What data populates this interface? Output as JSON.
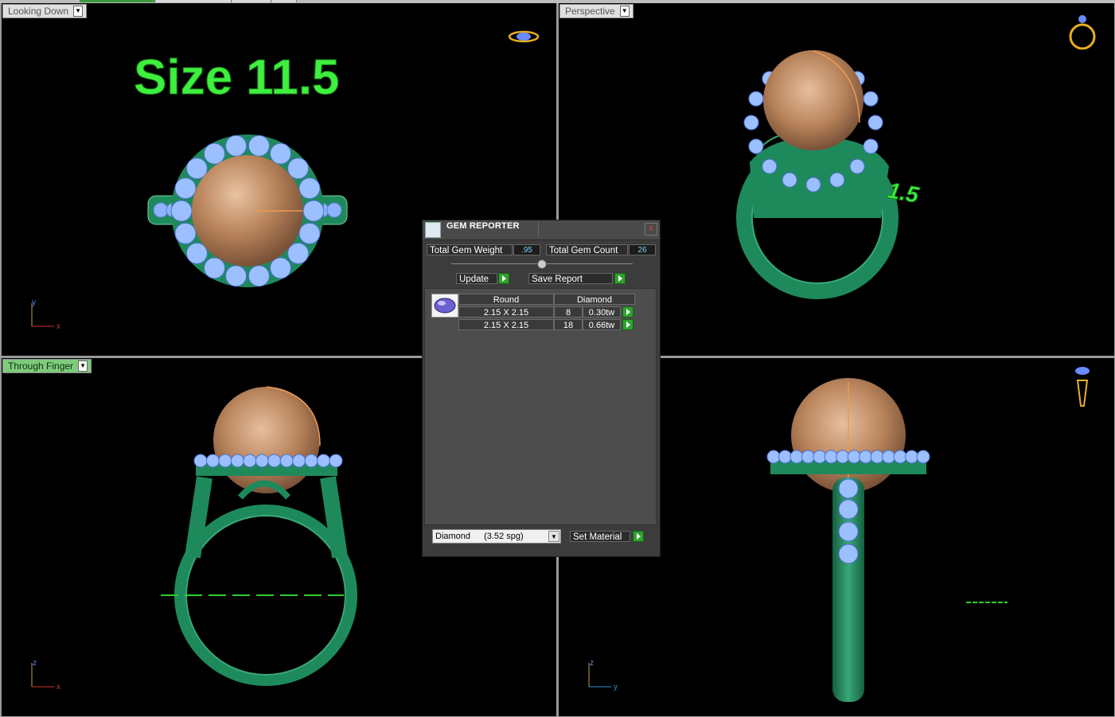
{
  "viewports": {
    "top_left": {
      "label": "Looking Down",
      "annotation": "Size 11.5",
      "axis1": "y",
      "axis2": "x"
    },
    "top_right": {
      "label": "Perspective",
      "annotation": "1.5"
    },
    "bottom_left": {
      "label": "Through Finger",
      "axis1": "z",
      "axis2": "x"
    },
    "bottom_right": {
      "axis1": "z",
      "axis2": "y"
    }
  },
  "gem_reporter": {
    "title": "GEM REPORTER",
    "close": "x",
    "total_weight_label": "Total Gem Weight",
    "total_weight_value": ".95",
    "total_count_label": "Total Gem Count",
    "total_count_value": "26",
    "update_label": "Update",
    "save_report_label": "Save Report",
    "table": {
      "shape": "Round",
      "material": "Diamond",
      "rows": [
        {
          "size": "2.15 X 2.15",
          "count": "8",
          "weight": "0.30tw"
        },
        {
          "size": "2.15 X 2.15",
          "count": "18",
          "weight": "0.66tw"
        }
      ]
    },
    "material_select": {
      "name": "Diamond",
      "sg": "(3.52 spg)"
    },
    "set_material_label": "Set Material"
  },
  "colors": {
    "metal": "#1e8a5c",
    "metal_light": "#3aa878",
    "pearl": "#b8835a",
    "pearl_light": "#e6bfa0",
    "diamond": "#8fb4ff",
    "accent_green": "#2fd02f"
  }
}
